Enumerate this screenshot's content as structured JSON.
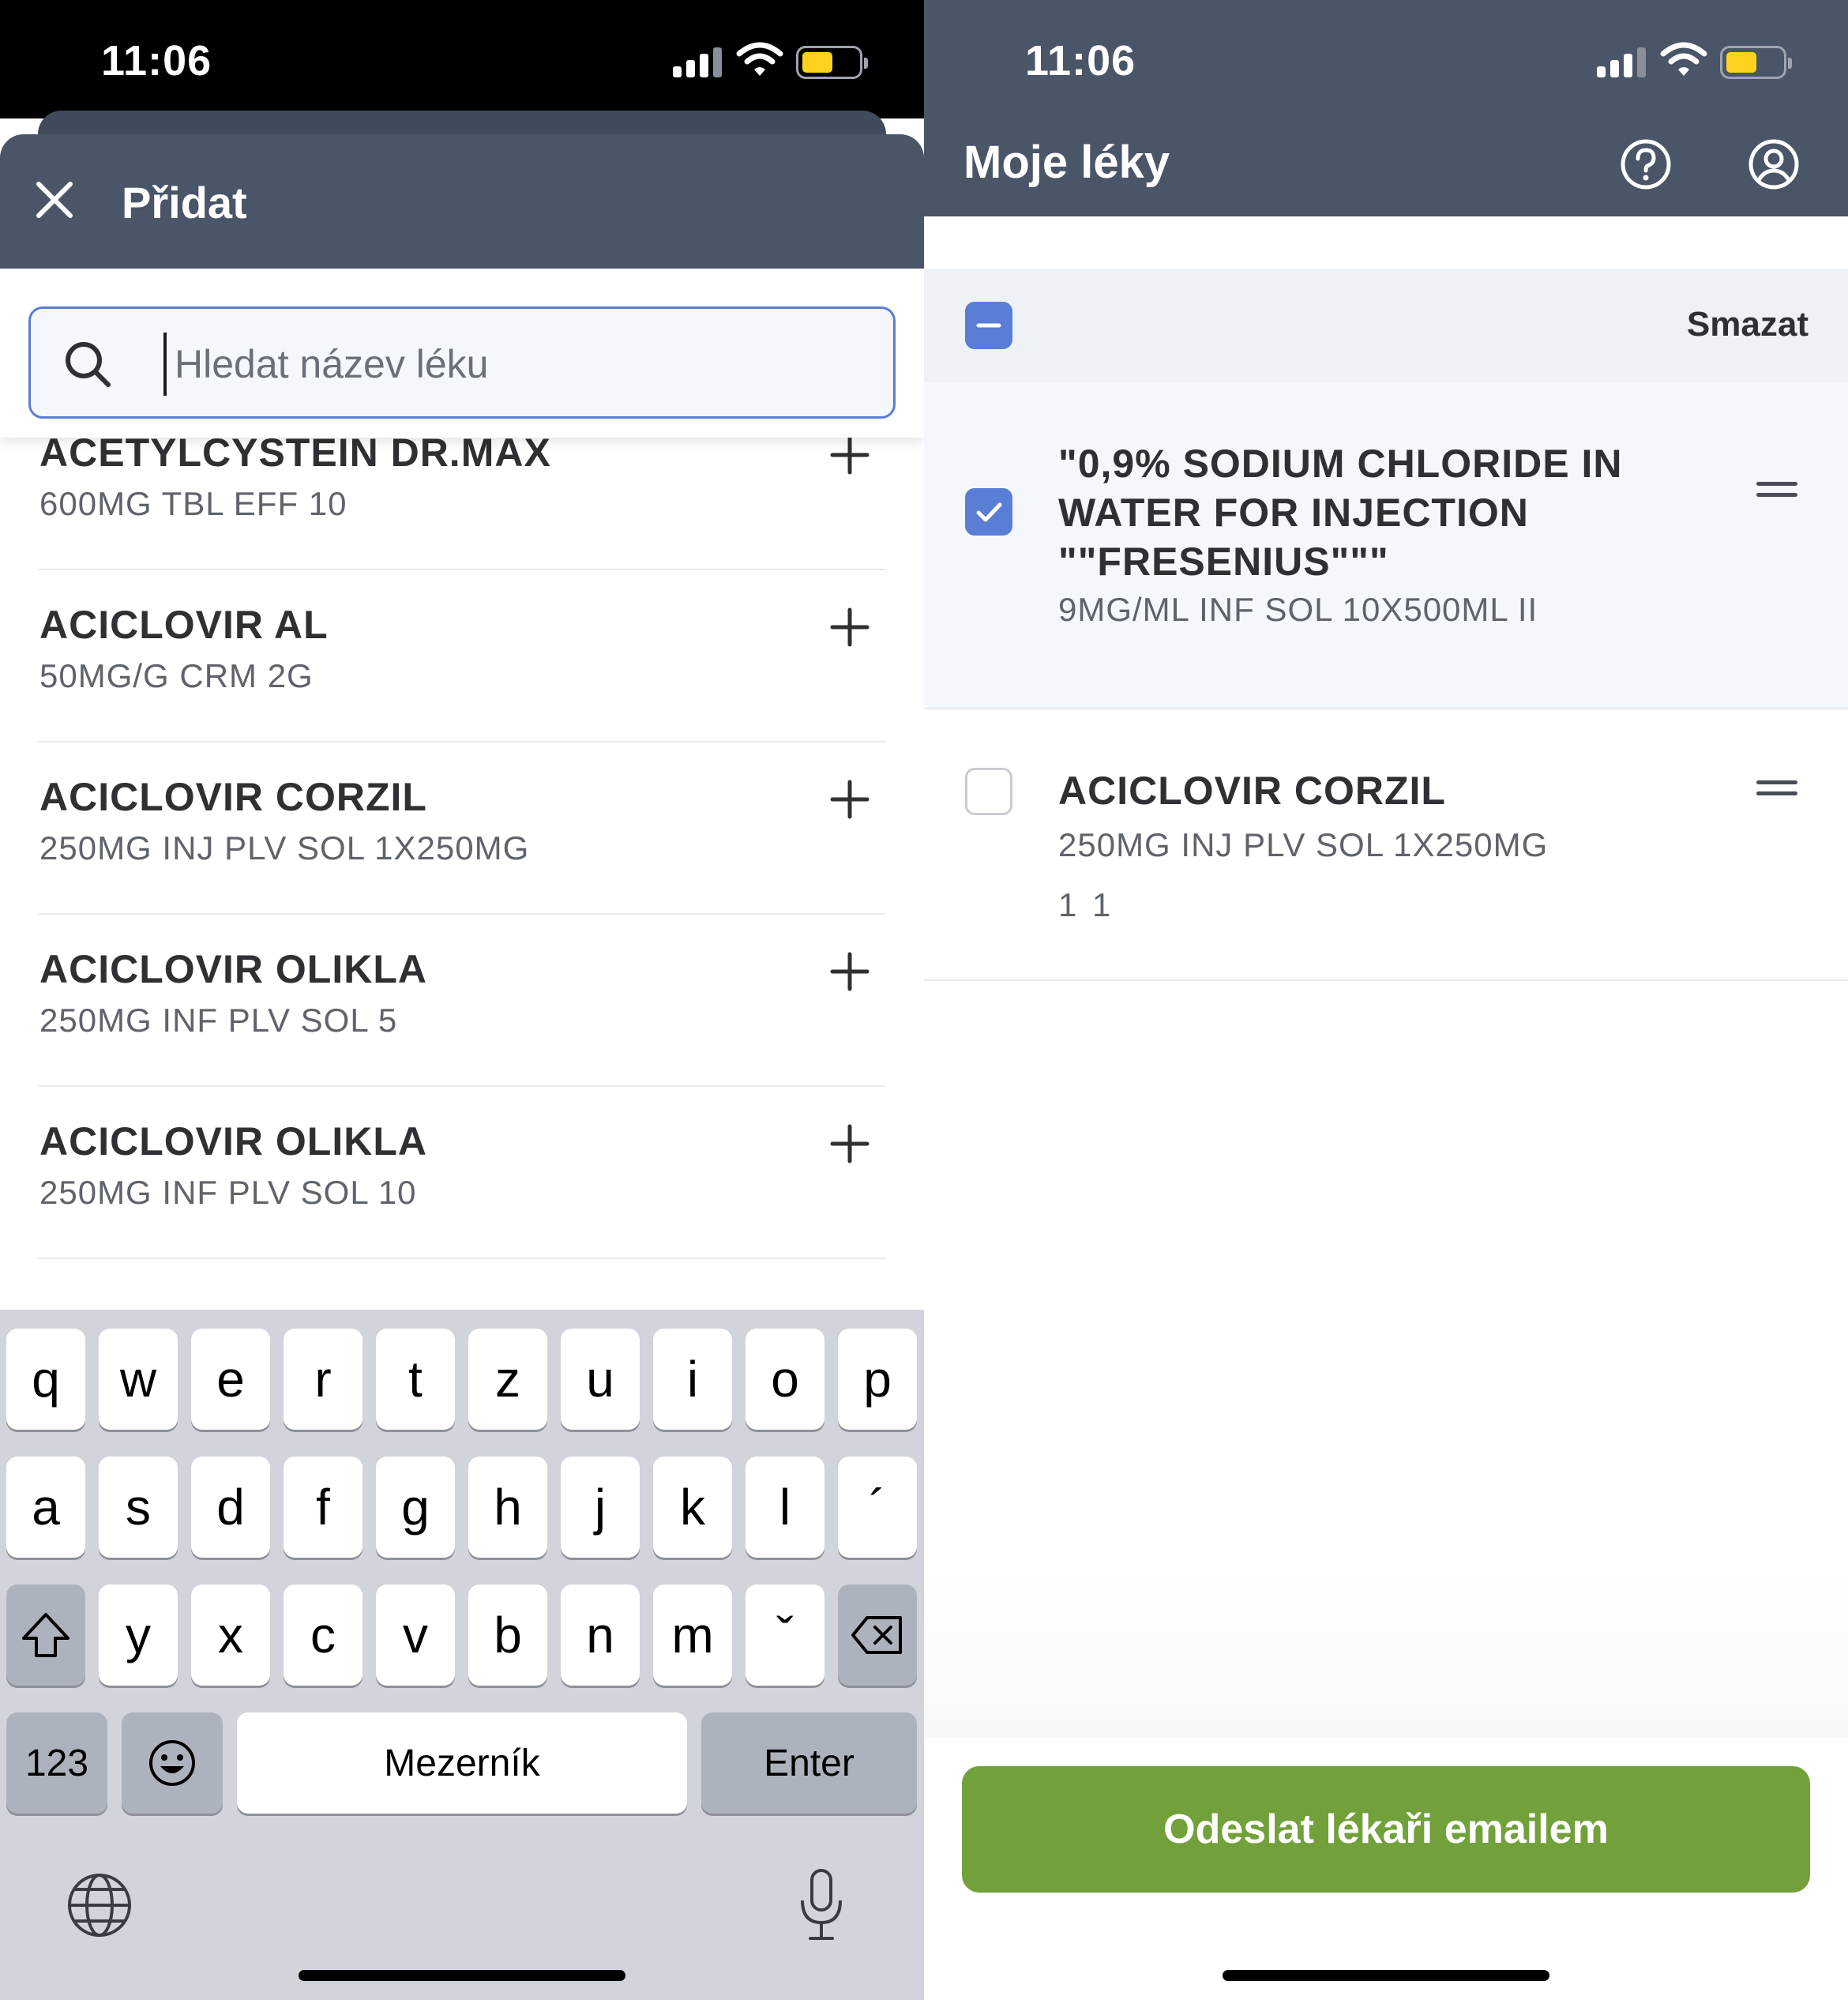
{
  "left_screen": {
    "status": {
      "time": "11:06"
    },
    "header": {
      "title": "Přidat"
    },
    "search": {
      "placeholder": "Hledat název léku",
      "value": ""
    },
    "drugs": [
      {
        "name": "ACETYLCYSTEIN DR.MAX",
        "desc": "600MG TBL EFF 10"
      },
      {
        "name": "ACICLOVIR AL",
        "desc": "50MG/G CRM 2G"
      },
      {
        "name": "ACICLOVIR CORZIL",
        "desc": "250MG INJ PLV SOL 1X250MG"
      },
      {
        "name": "ACICLOVIR OLIKLA",
        "desc": "250MG INF PLV SOL 5"
      },
      {
        "name": "ACICLOVIR OLIKLA",
        "desc": "250MG INF PLV SOL 10"
      }
    ],
    "keyboard": {
      "row1": [
        "q",
        "w",
        "e",
        "r",
        "t",
        "z",
        "u",
        "i",
        "o",
        "p"
      ],
      "row2": [
        "a",
        "s",
        "d",
        "f",
        "g",
        "h",
        "j",
        "k",
        "l",
        "´"
      ],
      "row3": [
        "y",
        "x",
        "c",
        "v",
        "b",
        "n",
        "m",
        "ˇ"
      ],
      "numbers": "123",
      "space": "Mezerník",
      "enter": "Enter"
    }
  },
  "right_screen": {
    "status": {
      "time": "11:06"
    },
    "header": {
      "title": "Moje léky"
    },
    "select_bar": {
      "delete_label": "Smazat"
    },
    "medications": [
      {
        "name": "\"0,9% SODIUM CHLORIDE IN WATER FOR INJECTION \"\"FRESENIUS\"\"\"",
        "desc": "9MG/ML INF SOL 10X500ML II",
        "qty": "",
        "checked": true
      },
      {
        "name": "ACICLOVIR CORZIL",
        "desc": "250MG INJ PLV SOL 1X250MG",
        "qty": "1 1",
        "checked": false
      }
    ],
    "send_button": "Odeslat lékaři emailem"
  },
  "colors": {
    "header": "#4a5568",
    "accent": "#5a7dd6",
    "send_button": "#72a03a",
    "keyboard_bg": "#d1d4db"
  }
}
